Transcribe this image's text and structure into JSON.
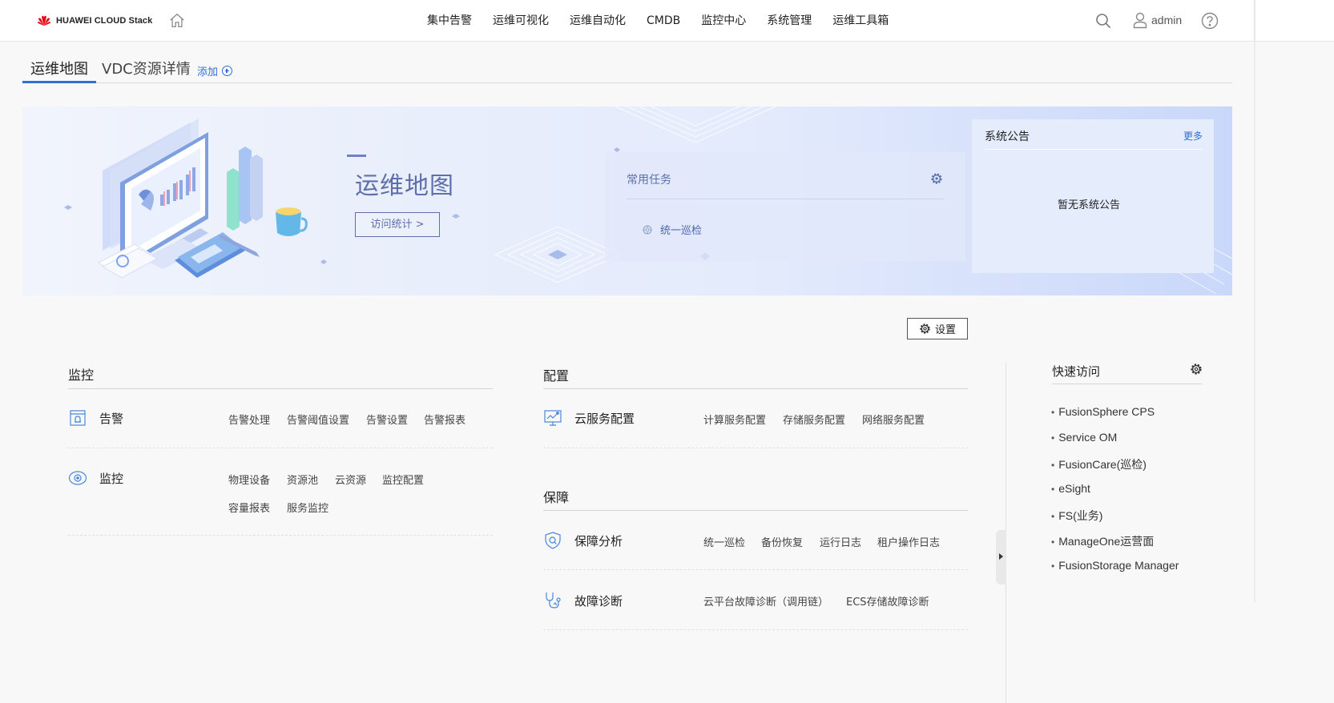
{
  "header": {
    "logo_text": "HUAWEI CLOUD Stack",
    "nav": [
      "集中告警",
      "运维可视化",
      "运维自动化",
      "CMDB",
      "监控中心",
      "系统管理",
      "运维工具箱"
    ],
    "user": "admin"
  },
  "tabs": {
    "items": [
      "运维地图",
      "VDC资源详情"
    ],
    "active": "运维地图",
    "add_label": "添加"
  },
  "banner": {
    "title": "运维地图",
    "visit_button": "访问统计 >",
    "tasks": {
      "title": "常用任务",
      "items": [
        "统一巡检"
      ]
    },
    "notice": {
      "title": "系统公告",
      "more": "更多",
      "empty": "暂无系统公告"
    }
  },
  "settings_label": "设置",
  "monitor": {
    "title": "监控",
    "alarm": {
      "label": "告警",
      "links": [
        "告警处理",
        "告警阈值设置",
        "告警设置",
        "告警报表"
      ]
    },
    "monitoring": {
      "label": "监控",
      "links": [
        "物理设备",
        "资源池",
        "云资源",
        "监控配置",
        "容量报表",
        "服务监控"
      ]
    }
  },
  "config": {
    "title": "配置",
    "cloud_service": {
      "label": "云服务配置",
      "links": [
        "计算服务配置",
        "存储服务配置",
        "网络服务配置"
      ]
    }
  },
  "guarantee": {
    "title": "保障",
    "analysis": {
      "label": "保障分析",
      "links": [
        "统一巡检",
        "备份恢复",
        "运行日志",
        "租户操作日志"
      ]
    },
    "diagnosis": {
      "label": "故障诊断",
      "links": [
        "云平台故障诊断（调用链）",
        "ECS存储故障诊断"
      ]
    }
  },
  "quick_access": {
    "title": "快速访问",
    "items": [
      "FusionSphere CPS",
      "Service OM",
      "FusionCare(巡检)",
      "eSight",
      "FS(业务)",
      "ManageOne运营面",
      "FusionStorage Manager"
    ]
  },
  "colors": {
    "accent": "#2f6fd7",
    "banner_text": "#5d70a9",
    "background": "#f8f8f8"
  }
}
